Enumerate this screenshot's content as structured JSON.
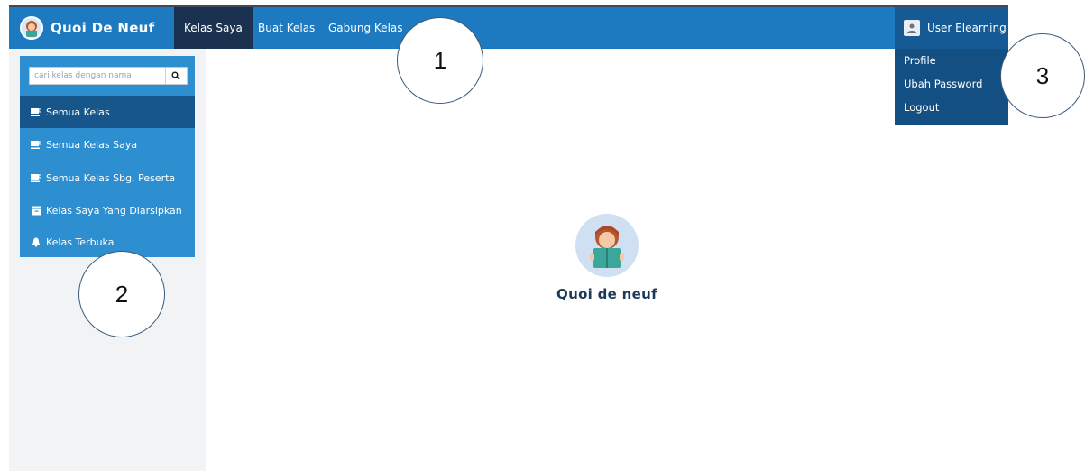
{
  "brand": {
    "name": "Quoi De Neuf"
  },
  "nav": {
    "items": [
      {
        "label": "Kelas Saya",
        "active": true
      },
      {
        "label": "Buat Kelas",
        "active": false
      },
      {
        "label": "Gabung Kelas",
        "active": false
      }
    ]
  },
  "user": {
    "name": "User Elearning",
    "menu": [
      {
        "label": "Profile"
      },
      {
        "label": "Ubah Password"
      },
      {
        "label": "Logout"
      }
    ]
  },
  "sidebar": {
    "search_placeholder": "cari kelas dengan nama",
    "items": [
      {
        "label": "Semua Kelas",
        "icon": "coffee-icon",
        "active": true
      },
      {
        "label": "Semua Kelas Saya",
        "icon": "coffee-icon",
        "active": false
      },
      {
        "label": "Semua Kelas Sbg. Peserta",
        "icon": "coffee-icon",
        "active": false
      },
      {
        "label": "Kelas Saya Yang Diarsipkan",
        "icon": "archive-icon",
        "active": false
      },
      {
        "label": "Kelas Terbuka",
        "icon": "bell-icon",
        "active": false
      }
    ]
  },
  "main": {
    "title": "Quoi de neuf"
  },
  "callouts": [
    "1",
    "2",
    "3"
  ],
  "colors": {
    "navbar": "#1d7ac0",
    "nav_active": "#1a3150",
    "sidebar": "#2d8ed0",
    "sidebar_active": "#17568a",
    "dropdown": "#134f82"
  }
}
